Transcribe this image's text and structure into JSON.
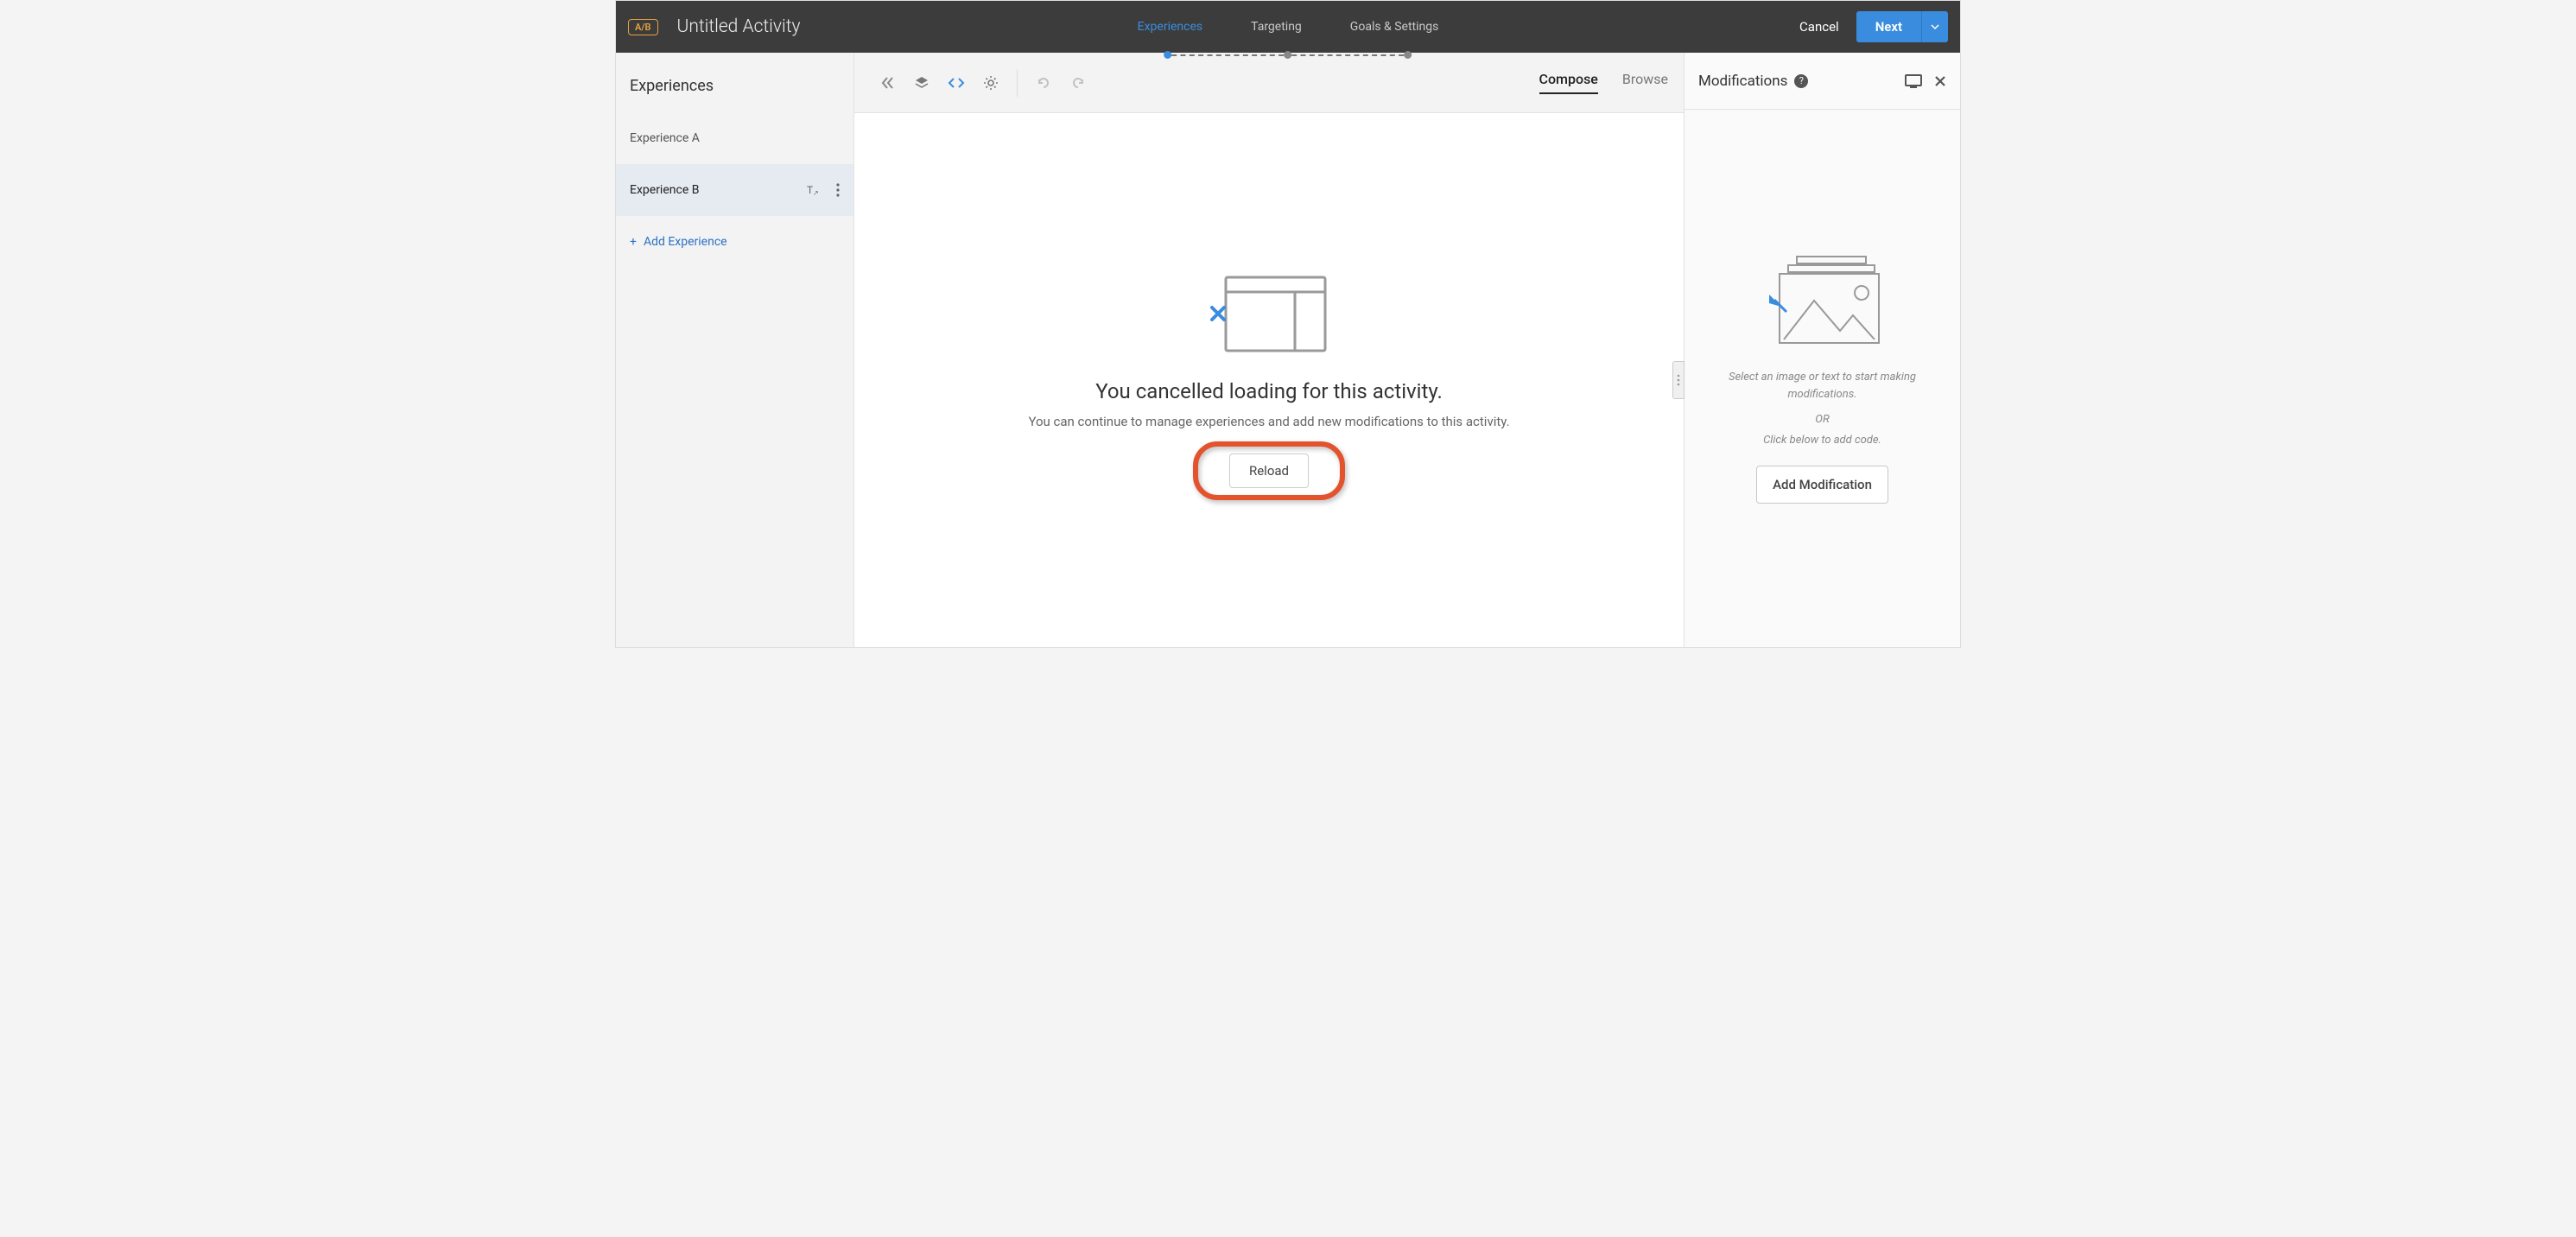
{
  "header": {
    "badge": "A/B",
    "title": "Untitled Activity",
    "steps": [
      "Experiences",
      "Targeting",
      "Goals & Settings"
    ],
    "cancel": "Cancel",
    "next": "Next"
  },
  "sidebar": {
    "title": "Experiences",
    "items": [
      {
        "label": "Experience A"
      },
      {
        "label": "Experience B"
      }
    ],
    "add": "Add Experience"
  },
  "toolbar": {
    "tabs": {
      "compose": "Compose",
      "browse": "Browse"
    }
  },
  "canvas": {
    "empty_title": "You cancelled loading for this activity.",
    "empty_sub": "You can continue to manage experiences and add new modifications to this activity.",
    "reload": "Reload"
  },
  "mods": {
    "title": "Modifications",
    "hint1": "Select an image or text to start making modifications.",
    "hint_or": "OR",
    "hint2": "Click below to add code.",
    "add": "Add Modification"
  }
}
